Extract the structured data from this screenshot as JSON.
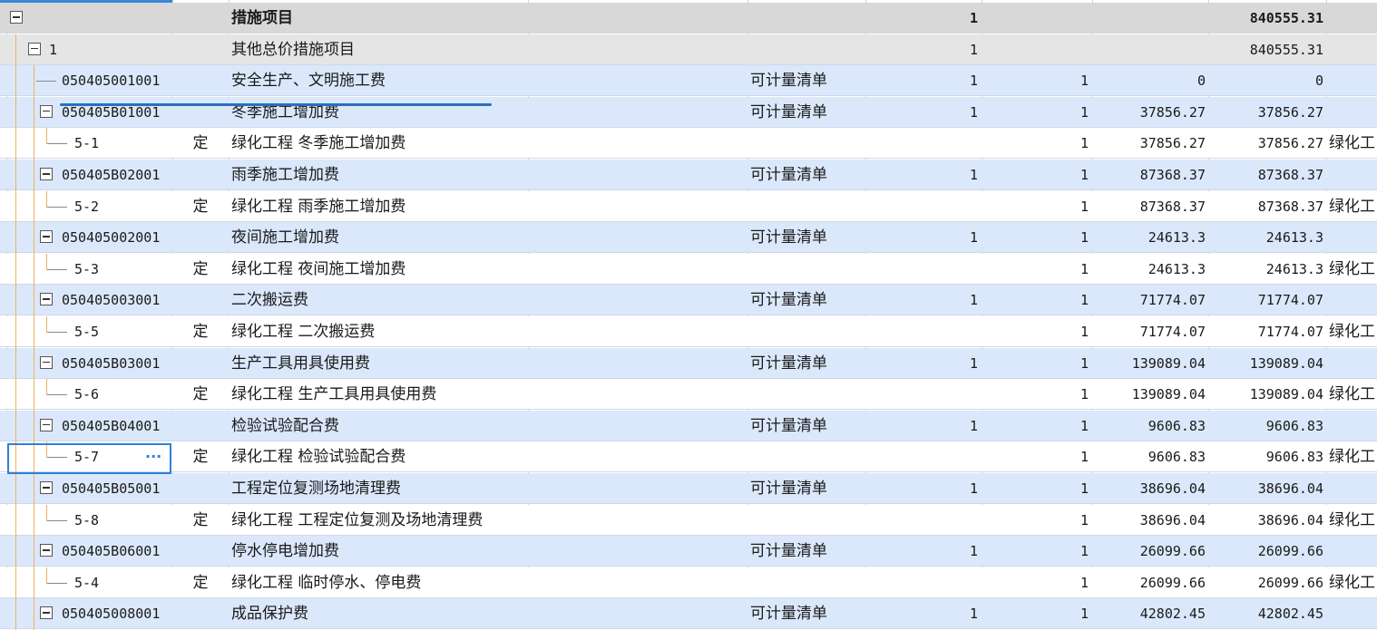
{
  "colors": {
    "group_bg": "#d8d8d8",
    "bill_bg": "#dbe8fb",
    "quota_bg": "#ffffff",
    "focus": "#2f80d6",
    "tree_line": "#f0b060"
  },
  "rows": [
    {
      "kind": "group",
      "code": "",
      "type": "",
      "name": "措施项目",
      "category": "",
      "unit_qty": "1",
      "qty": "",
      "price": "",
      "total": "840555.31",
      "extra": ""
    },
    {
      "kind": "subgroup",
      "code": "1",
      "type": "",
      "name": "其他总价措施项目",
      "category": "",
      "unit_qty": "1",
      "qty": "",
      "price": "",
      "total": "840555.31",
      "extra": ""
    },
    {
      "kind": "bill-leaf",
      "code": "050405001001",
      "type": "",
      "name": "安全生产、文明施工费",
      "category": "可计量清单",
      "unit_qty": "1",
      "qty": "1",
      "price": "0",
      "total": "0",
      "extra": ""
    },
    {
      "kind": "bill",
      "code": "050405B01001",
      "type": "",
      "name": "冬季施工增加费",
      "category": "可计量清单",
      "unit_qty": "1",
      "qty": "1",
      "price": "37856.27",
      "total": "37856.27",
      "extra": ""
    },
    {
      "kind": "quota",
      "code": "5-1",
      "type": "定",
      "name": "绿化工程 冬季施工增加费",
      "category": "",
      "unit_qty": "",
      "qty": "1",
      "price": "37856.27",
      "total": "37856.27",
      "extra": "绿化工"
    },
    {
      "kind": "bill",
      "code": "050405B02001",
      "type": "",
      "name": "雨季施工增加费",
      "category": "可计量清单",
      "unit_qty": "1",
      "qty": "1",
      "price": "87368.37",
      "total": "87368.37",
      "extra": ""
    },
    {
      "kind": "quota",
      "code": "5-2",
      "type": "定",
      "name": "绿化工程 雨季施工增加费",
      "category": "",
      "unit_qty": "",
      "qty": "1",
      "price": "87368.37",
      "total": "87368.37",
      "extra": "绿化工"
    },
    {
      "kind": "bill",
      "code": "050405002001",
      "type": "",
      "name": "夜间施工增加费",
      "category": "可计量清单",
      "unit_qty": "1",
      "qty": "1",
      "price": "24613.3",
      "total": "24613.3",
      "extra": ""
    },
    {
      "kind": "quota",
      "code": "5-3",
      "type": "定",
      "name": "绿化工程 夜间施工增加费",
      "category": "",
      "unit_qty": "",
      "qty": "1",
      "price": "24613.3",
      "total": "24613.3",
      "extra": "绿化工"
    },
    {
      "kind": "bill",
      "code": "050405003001",
      "type": "",
      "name": "二次搬运费",
      "category": "可计量清单",
      "unit_qty": "1",
      "qty": "1",
      "price": "71774.07",
      "total": "71774.07",
      "extra": ""
    },
    {
      "kind": "quota",
      "code": "5-5",
      "type": "定",
      "name": "绿化工程 二次搬运费",
      "category": "",
      "unit_qty": "",
      "qty": "1",
      "price": "71774.07",
      "total": "71774.07",
      "extra": "绿化工"
    },
    {
      "kind": "bill",
      "code": "050405B03001",
      "type": "",
      "name": "生产工具用具使用费",
      "category": "可计量清单",
      "unit_qty": "1",
      "qty": "1",
      "price": "139089.04",
      "total": "139089.04",
      "extra": ""
    },
    {
      "kind": "quota",
      "code": "5-6",
      "type": "定",
      "name": "绿化工程 生产工具用具使用费",
      "category": "",
      "unit_qty": "",
      "qty": "1",
      "price": "139089.04",
      "total": "139089.04",
      "extra": "绿化工"
    },
    {
      "kind": "bill",
      "code": "050405B04001",
      "type": "",
      "name": "检验试验配合费",
      "category": "可计量清单",
      "unit_qty": "1",
      "qty": "1",
      "price": "9606.83",
      "total": "9606.83",
      "extra": ""
    },
    {
      "kind": "quota",
      "code": "5-7",
      "type": "定",
      "name": "绿化工程 检验试验配合费",
      "category": "",
      "unit_qty": "",
      "qty": "1",
      "price": "9606.83",
      "total": "9606.83",
      "extra": "绿化工"
    },
    {
      "kind": "bill",
      "code": "050405B05001",
      "type": "",
      "name": "工程定位复测场地清理费",
      "category": "可计量清单",
      "unit_qty": "1",
      "qty": "1",
      "price": "38696.04",
      "total": "38696.04",
      "extra": ""
    },
    {
      "kind": "quota",
      "code": "5-8",
      "type": "定",
      "name": "绿化工程 工程定位复测及场地清理费",
      "category": "",
      "unit_qty": "",
      "qty": "1",
      "price": "38696.04",
      "total": "38696.04",
      "extra": "绿化工"
    },
    {
      "kind": "bill",
      "code": "050405B06001",
      "type": "",
      "name": "停水停电增加费",
      "category": "可计量清单",
      "unit_qty": "1",
      "qty": "1",
      "price": "26099.66",
      "total": "26099.66",
      "extra": ""
    },
    {
      "kind": "quota",
      "code": "5-4",
      "type": "定",
      "name": "绿化工程 临时停水、停电费",
      "category": "",
      "unit_qty": "",
      "qty": "1",
      "price": "26099.66",
      "total": "26099.66",
      "extra": "绿化工"
    },
    {
      "kind": "bill",
      "code": "050405008001",
      "type": "",
      "name": "成品保护费",
      "category": "可计量清单",
      "unit_qty": "1",
      "qty": "1",
      "price": "42802.45",
      "total": "42802.45",
      "extra": ""
    }
  ],
  "selected_cell_action": "···"
}
